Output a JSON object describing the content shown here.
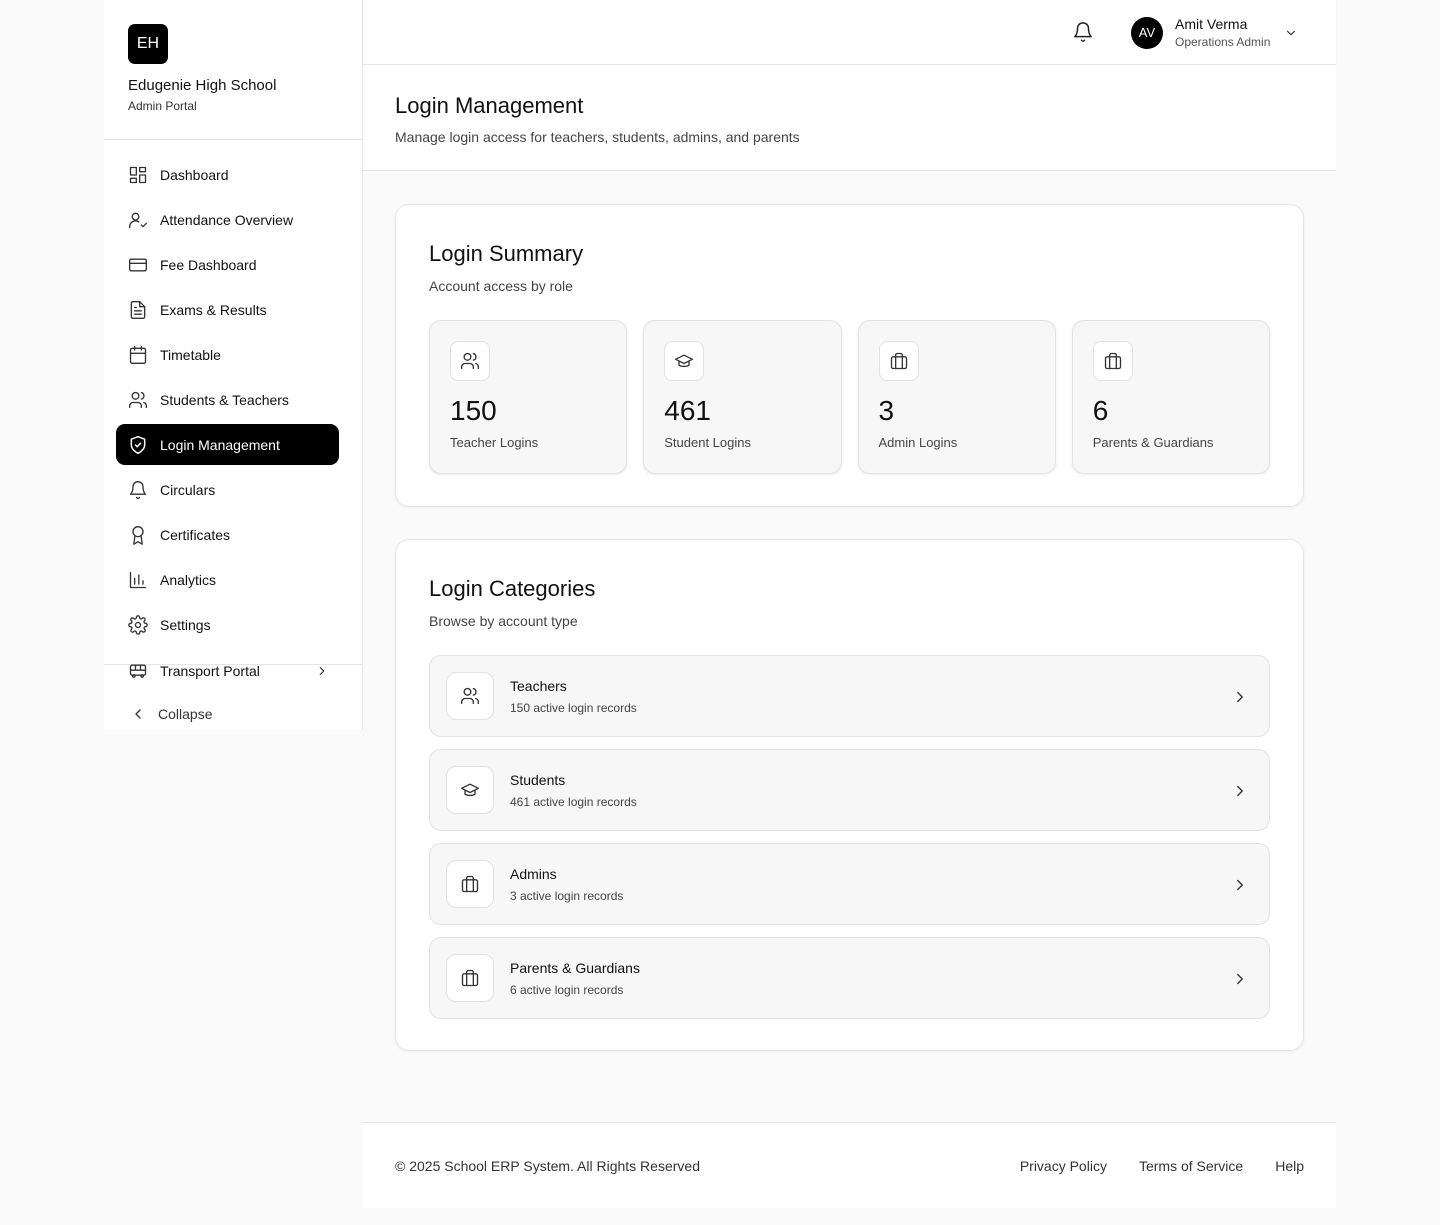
{
  "brand": {
    "initials": "EH",
    "name": "Edugenie High School",
    "subtitle": "Admin Portal"
  },
  "sidebar": {
    "items": [
      {
        "label": "Dashboard",
        "icon": "dashboard-icon"
      },
      {
        "label": "Attendance Overview",
        "icon": "user-check-icon"
      },
      {
        "label": "Fee Dashboard",
        "icon": "credit-card-icon"
      },
      {
        "label": "Exams & Results",
        "icon": "file-text-icon"
      },
      {
        "label": "Timetable",
        "icon": "calendar-icon"
      },
      {
        "label": "Students & Teachers",
        "icon": "users-icon"
      },
      {
        "label": "Login Management",
        "icon": "shield-check-icon",
        "active": true
      },
      {
        "label": "Circulars",
        "icon": "bell-icon"
      },
      {
        "label": "Certificates",
        "icon": "award-icon"
      },
      {
        "label": "Analytics",
        "icon": "bar-chart-icon"
      },
      {
        "label": "Settings",
        "icon": "gear-icon"
      }
    ],
    "transport": {
      "label": "Transport Portal",
      "icon": "bus-icon"
    },
    "collapse_label": "Collapse"
  },
  "header": {
    "user": {
      "initials": "AV",
      "name": "Amit Verma",
      "role": "Operations Admin"
    }
  },
  "page": {
    "title": "Login Management",
    "subtitle": "Manage login access for teachers, students, admins, and parents"
  },
  "summary": {
    "title": "Login Summary",
    "subtitle": "Account access by role",
    "stats": [
      {
        "value": "150",
        "label": "Teacher Logins",
        "icon": "users-icon"
      },
      {
        "value": "461",
        "label": "Student Logins",
        "icon": "graduation-cap-icon"
      },
      {
        "value": "3",
        "label": "Admin Logins",
        "icon": "briefcase-icon"
      },
      {
        "value": "6",
        "label": "Parents & Guardians",
        "icon": "briefcase-icon"
      }
    ]
  },
  "categories": {
    "title": "Login Categories",
    "subtitle": "Browse by account type",
    "items": [
      {
        "name": "Teachers",
        "desc": "150 active login records",
        "icon": "users-icon"
      },
      {
        "name": "Students",
        "desc": "461 active login records",
        "icon": "graduation-cap-icon"
      },
      {
        "name": "Admins",
        "desc": "3 active login records",
        "icon": "briefcase-icon"
      },
      {
        "name": "Parents & Guardians",
        "desc": "6 active login records",
        "icon": "briefcase-icon"
      }
    ]
  },
  "footer": {
    "copyright": "© 2025 School ERP System. All Rights Reserved",
    "links": [
      "Privacy Policy",
      "Terms of Service",
      "Help"
    ]
  },
  "colors": {
    "accent": "#000000",
    "background": "#fafafa",
    "border": "#e5e5e5"
  }
}
